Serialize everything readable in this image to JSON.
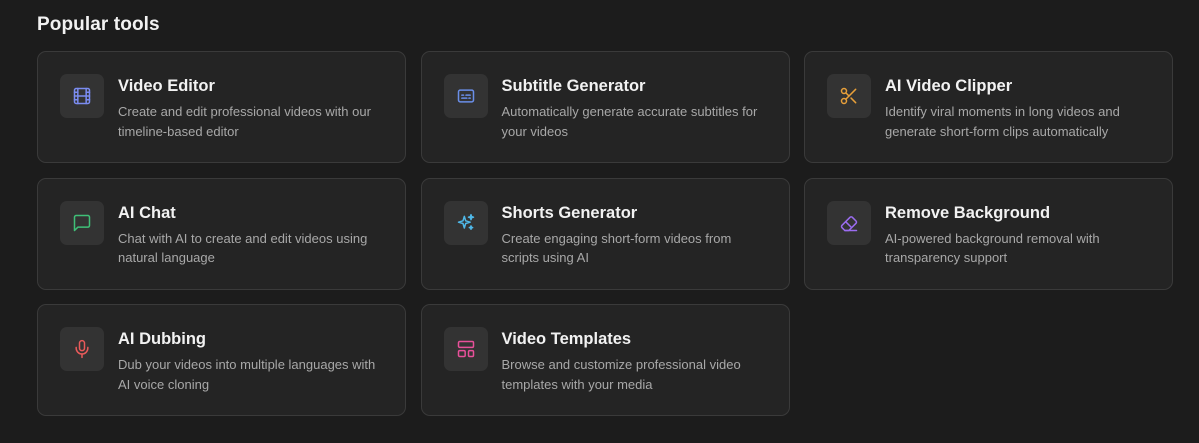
{
  "section": {
    "title": "Popular tools"
  },
  "tools": [
    {
      "title": "Video Editor",
      "description": "Create and edit professional videos with our timeline-based editor",
      "icon": "film-icon",
      "color": "#7b8cf0"
    },
    {
      "title": "Subtitle Generator",
      "description": "Automatically generate accurate subtitles for your videos",
      "icon": "captions-icon",
      "color": "#6a8ee8"
    },
    {
      "title": "AI Video Clipper",
      "description": "Identify viral moments in long videos and generate short-form clips automatically",
      "icon": "scissors-icon",
      "color": "#e8a03a"
    },
    {
      "title": "AI Chat",
      "description": "Chat with AI to create and edit videos using natural language",
      "icon": "chat-bubble-icon",
      "color": "#3fbf77"
    },
    {
      "title": "Shorts Generator",
      "description": "Create engaging short-form videos from scripts using AI",
      "icon": "sparkles-icon",
      "color": "#4fb8e8"
    },
    {
      "title": "Remove Background",
      "description": "AI-powered background removal with transparency support",
      "icon": "eraser-icon",
      "color": "#9b6cf0"
    },
    {
      "title": "AI Dubbing",
      "description": "Dub your videos into multiple languages with AI voice cloning",
      "icon": "microphone-icon",
      "color": "#e85a5a"
    },
    {
      "title": "Video Templates",
      "description": "Browse and customize professional video templates with your media",
      "icon": "layout-template-icon",
      "color": "#e8509a"
    }
  ]
}
